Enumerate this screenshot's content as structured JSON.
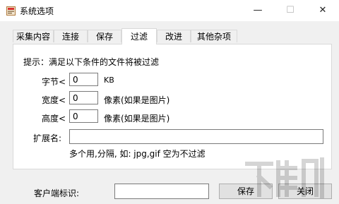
{
  "window": {
    "title": "系统选项",
    "controls": {
      "minimize": "—",
      "maximize": "☐",
      "close": "✕"
    }
  },
  "tabs": [
    {
      "label": "采集内容",
      "active": false
    },
    {
      "label": "连接",
      "active": false
    },
    {
      "label": "保存",
      "active": false
    },
    {
      "label": "过滤",
      "active": true
    },
    {
      "label": "改进",
      "active": false
    },
    {
      "label": "其他杂项",
      "active": false
    }
  ],
  "filter": {
    "hint": "提示：满足以下条件的文件将被过滤",
    "bytes": {
      "label": "字节<",
      "value": "0",
      "unit": "KB"
    },
    "width": {
      "label": "宽度<",
      "value": "0",
      "unit": "像素(如果是图片)"
    },
    "height": {
      "label": "高度<",
      "value": "0",
      "unit": "像素(如果是图片)"
    },
    "extension": {
      "label": "扩展名:",
      "value": "",
      "note": "多个用,分隔, 如: jpg,gif 空为不过滤"
    }
  },
  "footer": {
    "client_id_label": "客户端标识:",
    "client_id_value": "",
    "save_label": "保存",
    "close_label": "关闭"
  },
  "icons": {
    "app": "app-icon",
    "watermark": "download-site-logo"
  },
  "colors": {
    "title_bg": "#ffffff",
    "dialog_bg": "#f0f0f0",
    "panel_bg": "#ffffff"
  }
}
